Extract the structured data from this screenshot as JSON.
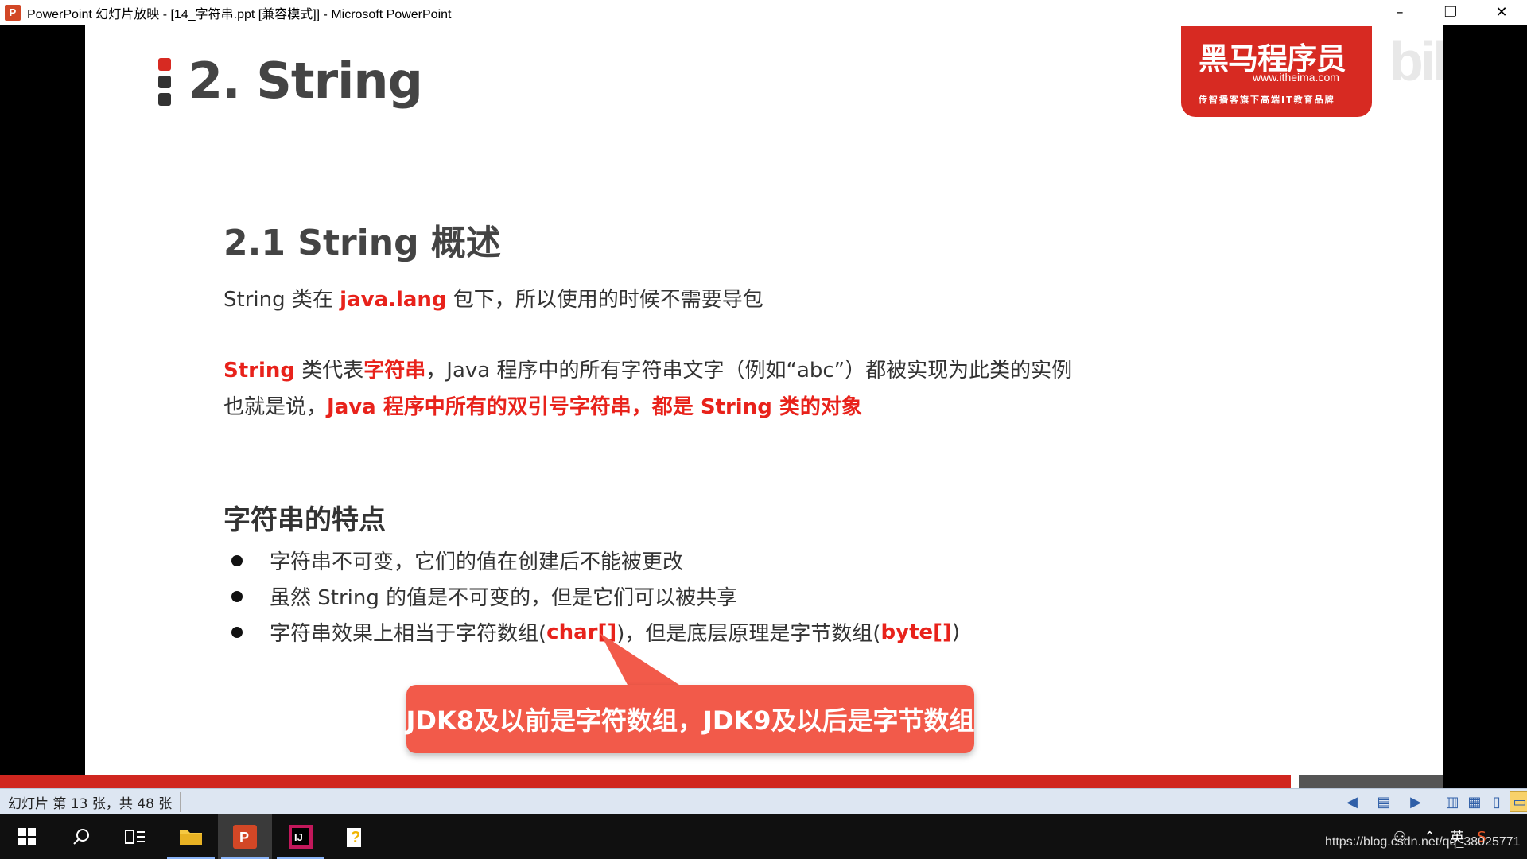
{
  "window": {
    "title": "PowerPoint 幻灯片放映 - [14_字符串.ppt [兼容模式]] - Microsoft PowerPoint",
    "app_icon": "P",
    "minimize": "–",
    "restore": "❐",
    "close": "✕"
  },
  "slide": {
    "title": "2. String",
    "logo": {
      "main": "黑马程序员",
      "url": "www.itheima.com",
      "sub": "传智播客旗下高端IT教育品牌"
    },
    "watermark": "bili",
    "section_heading": "2.1 String 概述",
    "line1": {
      "a": "String 类在 ",
      "red": "java.lang",
      "b": " 包下，所以使用的时候不需要导包"
    },
    "line2": {
      "red1": "String",
      "a": " 类代表",
      "red2": "字符串",
      "b": "，Java 程序中的所有字符串文字（例如“abc”）都被实现为此类的实例"
    },
    "line3": {
      "a": "也就是说，",
      "red": "Java 程序中所有的双引号字符串，都是 String 类的对象"
    },
    "features_heading": "字符串的特点",
    "bullets": [
      {
        "a": "字符串不可变，它们的值在创建后不能被更改"
      },
      {
        "a": "虽然 String 的值是不可变的，但是它们可以被共享"
      },
      {
        "a": "字符串效果上相当于字符数组( ",
        "red1": "char[]",
        "b": " )，但是底层原理是字节数组( ",
        "red2": "byte[]",
        "c": " )"
      }
    ],
    "callout": "JDK8及以前是字符数组，JDK9及以后是字节数组"
  },
  "statusbar": {
    "slide_info": "幻灯片 第 13 张，共 48 张"
  },
  "taskbar": {
    "url": "https://blog.csdn.net/qq_38025771",
    "ime": "英"
  },
  "colors": {
    "accent_red": "#e8221b",
    "callout": "#f25a4a",
    "logo_red": "#d72a22",
    "bar_red": "#d0261f"
  }
}
